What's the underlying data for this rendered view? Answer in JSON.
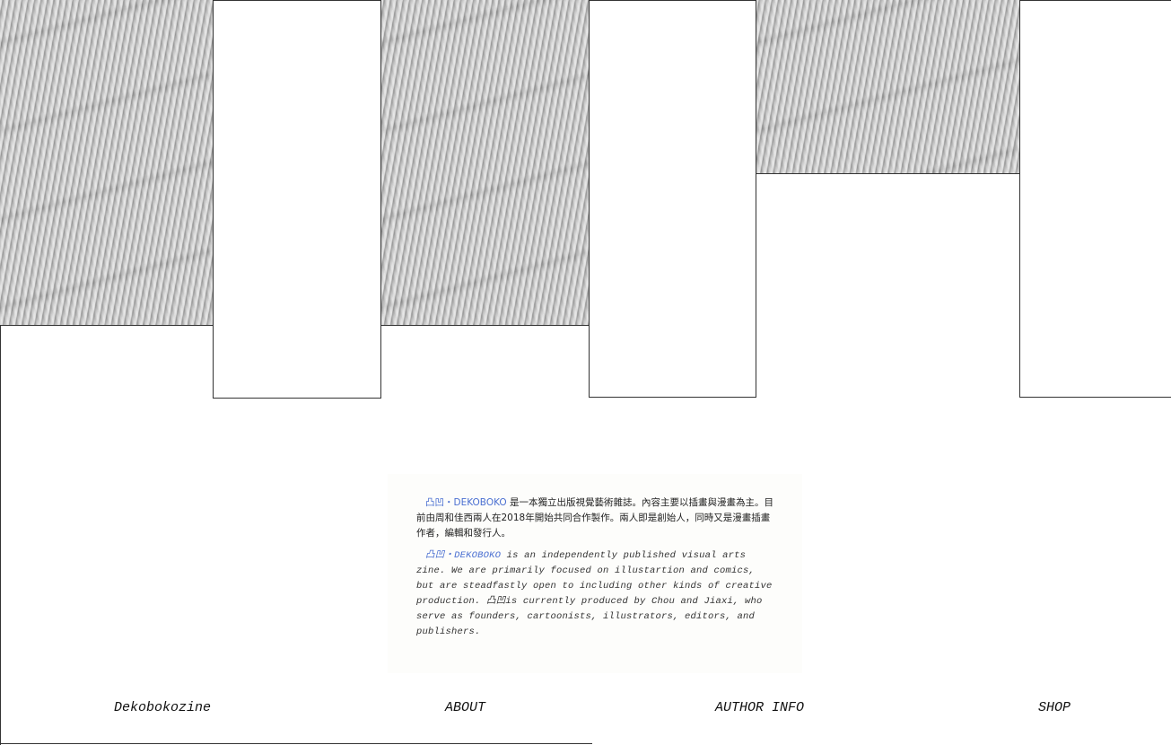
{
  "intro": {
    "brand_zh": "凸凹・DEKOBOKO",
    "zh_text": " 是一本獨立出版視覺藝術雜誌。內容主要以插畫與漫畫為主。目前由周和佳西兩人在2018年開始共同合作製作。兩人即是創始人，同時又是漫畫插畫作者，編輯和發行人。",
    "brand_en": "凸凹・DEKOBOKO",
    "en_text_1": " is an independently published visual arts zine. We are primarily focused on illustartion and comics, but are steadfastly open to including other kinds of creative production. ",
    "brand_short": "凸凹",
    "en_text_2": "is currently produced by Chou and Jiaxi, who serve as founders, cartoonists, illustrators, editors, and publishers."
  },
  "nav": {
    "home": "Dekobokozine",
    "about": "ABOUT",
    "author_info": "AUTHOR INFO",
    "shop": "SHOP"
  },
  "colors": {
    "brand_link": "#4a6fd1",
    "frame_line": "#333333"
  }
}
